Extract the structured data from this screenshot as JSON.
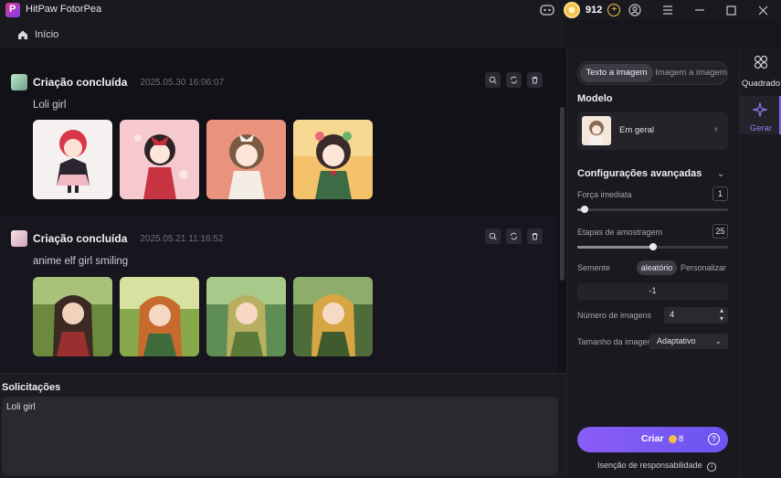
{
  "titlebar": {
    "app_title": "HitPaw FotorPea",
    "coins": "912"
  },
  "breadcrumb": {
    "home_label": "Início"
  },
  "feed": {
    "cards": [
      {
        "title": "Criação concluída",
        "date": "2025.05.30  16:06:07",
        "prompt": "Loli girl"
      },
      {
        "title": "Criação concluída",
        "date": "2025.05.21  11:16:52",
        "prompt": "anime elf girl smiling"
      }
    ]
  },
  "prompt_area": {
    "label": "Solicitações",
    "value": "Loli girl"
  },
  "panel": {
    "tabs": [
      "Texto a imagem",
      "Imagem a imagem"
    ],
    "model_title": "Modelo",
    "model_name": "Em geral",
    "advanced_title": "Configurações avançadas",
    "strength_label": "Força imediata",
    "strength_value": "1",
    "strength_fraction": 0.05,
    "steps_label": "Etapas de amostragem",
    "steps_value": "25",
    "steps_fraction": 0.5,
    "seed_label": "Semente",
    "seed_random": "aleatório",
    "seed_custom": "Personalizar",
    "seed_value": "-1",
    "num_images_label": "Número de imagens",
    "num_images_value": "4",
    "size_label": "Tamanho da imagem",
    "size_value": "Adaptativo",
    "create_label": "Criar",
    "create_cost": "8",
    "disclaimer": "Isenção de responsabilidade"
  },
  "rail": {
    "items": [
      "Quadrado",
      "Gerar"
    ]
  },
  "colors": {
    "accent": "#8b5cf6",
    "coin": "#f3c14b"
  }
}
